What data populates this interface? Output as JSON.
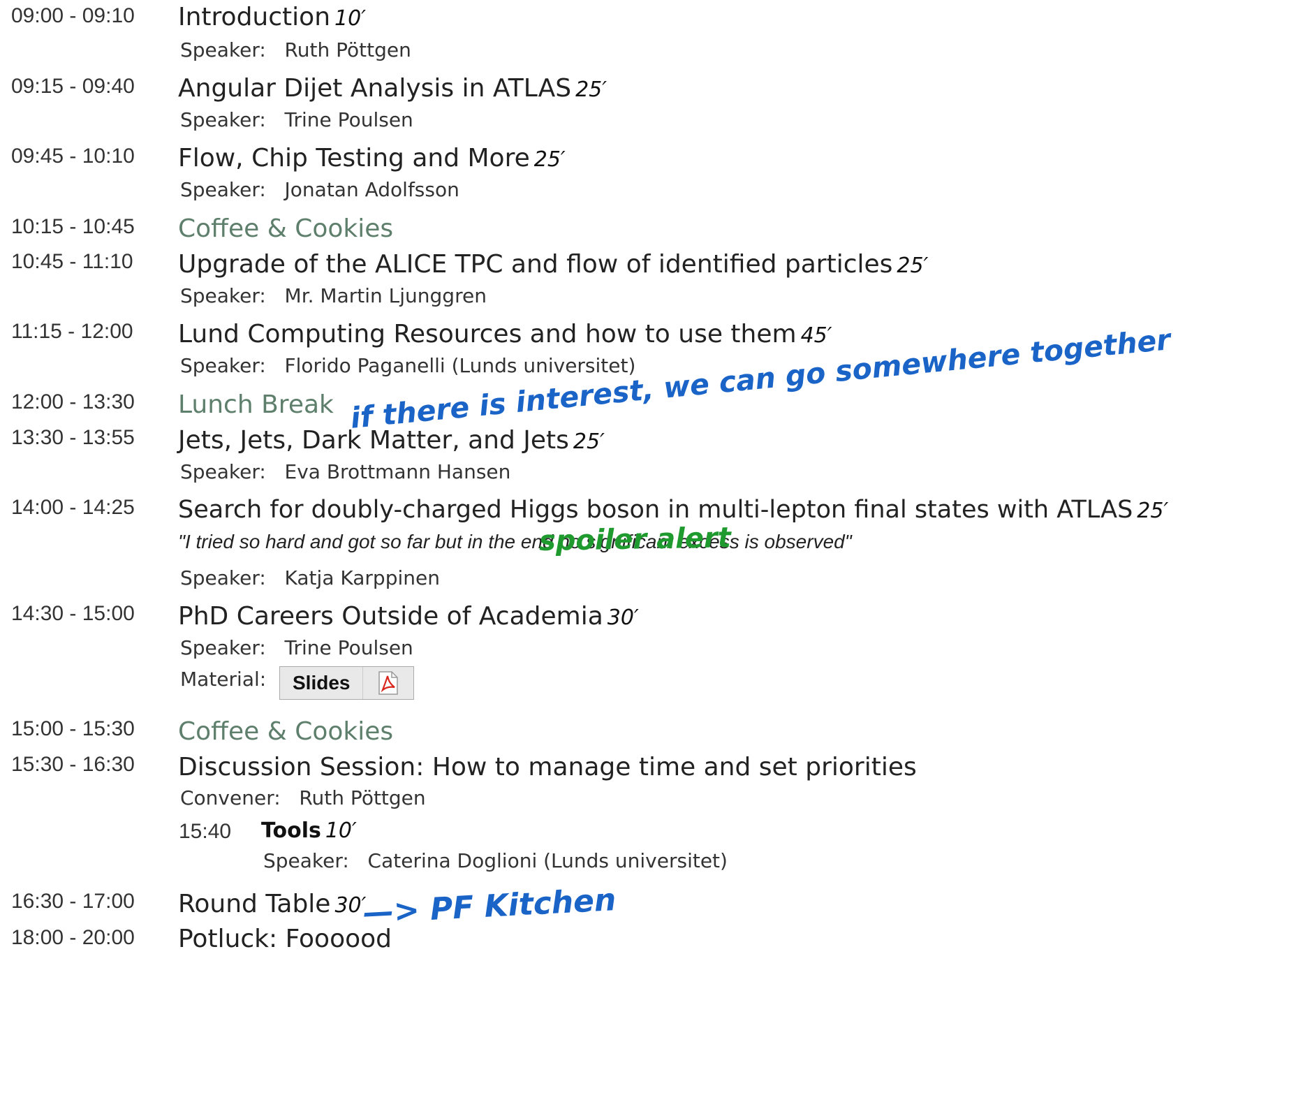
{
  "entries": [
    {
      "time": "09:00 - 09:10",
      "title": "Introduction",
      "duration": "10′",
      "speaker_label": "Speaker:",
      "speaker": "Ruth Pöttgen"
    },
    {
      "time": "09:15 - 09:40",
      "title": "Angular Dijet Analysis in ATLAS",
      "duration": "25′",
      "speaker_label": "Speaker:",
      "speaker": "Trine Poulsen"
    },
    {
      "time": "09:45 - 10:10",
      "title": "Flow, Chip Testing and More",
      "duration": "25′",
      "speaker_label": "Speaker:",
      "speaker": "Jonatan Adolfsson"
    },
    {
      "time": "10:15 - 10:45",
      "title": "Coffee & Cookies"
    },
    {
      "time": "10:45 - 11:10",
      "title": "Upgrade of the ALICE TPC and flow of identified particles",
      "duration": "25′",
      "speaker_label": "Speaker:",
      "speaker": "Mr. Martin Ljunggren"
    },
    {
      "time": "11:15 - 12:00",
      "title": "Lund Computing Resources and how to use them",
      "duration": "45′",
      "speaker_label": "Speaker:",
      "speaker": "Florido Paganelli (Lunds universitet)"
    },
    {
      "time": "12:00 - 13:30",
      "title": "Lunch Break"
    },
    {
      "time": "13:30 - 13:55",
      "title": "Jets, Jets, Dark Matter, and Jets",
      "duration": "25′",
      "speaker_label": "Speaker:",
      "speaker": "Eva Brottmann Hansen"
    },
    {
      "time": "14:00 - 14:25",
      "title": "Search for doubly-charged Higgs boson in multi-lepton final states with ATLAS",
      "duration": "25′",
      "description": "\"I tried so hard and got so far but in the end no significant excess is observed\"",
      "speaker_label": "Speaker:",
      "speaker": "Katja Karppinen"
    },
    {
      "time": "14:30 - 15:00",
      "title": "PhD Careers Outside of Academia",
      "duration": "30′",
      "speaker_label": "Speaker:",
      "speaker": "Trine Poulsen",
      "material_label": "Material:",
      "material_button": "Slides"
    },
    {
      "time": "15:00 - 15:30",
      "title": "Coffee & Cookies"
    },
    {
      "time": "15:30 - 16:30",
      "title": "Discussion Session: How to manage time and set priorities",
      "convener_label": "Convener:",
      "convener": "Ruth Pöttgen",
      "sub": {
        "time": "15:40",
        "title": "Tools",
        "duration": "10′",
        "speaker_label": "Speaker:",
        "speaker": "Caterina Doglioni (Lunds universitet)"
      }
    },
    {
      "time": "16:30 - 17:00",
      "title": "Round Table",
      "duration": "30′"
    },
    {
      "time": "18:00 - 20:00",
      "title": "Potluck: Foooood"
    }
  ],
  "annotations": {
    "lunch_note": "if there is interest, we can go somewhere together",
    "spoiler_note": "spoiler alert",
    "round_table_note": "—> PF Kitchen"
  },
  "icons": {
    "material": "pdf-icon"
  },
  "colors": {
    "break_title": "#5e7f6b",
    "annotation_blue": "#1a63c7",
    "annotation_green": "#1f9a2e"
  }
}
